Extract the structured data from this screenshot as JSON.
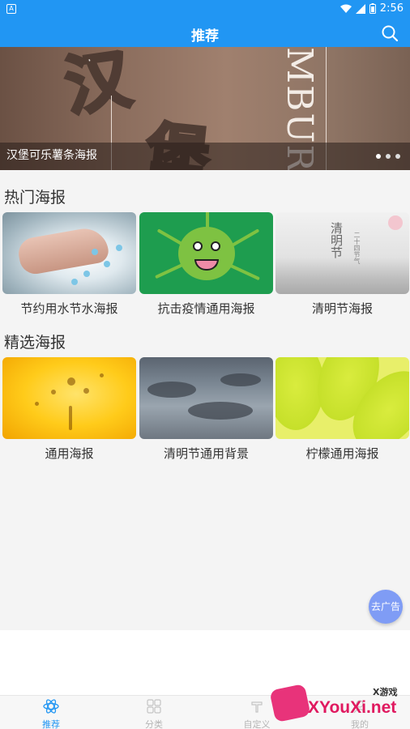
{
  "status_bar": {
    "time": "2:56",
    "left_icon": "app-notification-icon",
    "icons": [
      "wifi-icon",
      "signal-icon",
      "battery-icon"
    ]
  },
  "app_bar": {
    "title": "推荐",
    "search_icon": "search-icon"
  },
  "banner": {
    "caption": "汉堡可乐薯条海报",
    "deco_char_1": "汉",
    "deco_char_2": "堡",
    "deco_vertical_text": "MBUR",
    "slides": 3,
    "active_slide": 1
  },
  "sections": [
    {
      "title": "热门海报",
      "items": [
        {
          "label": "节约用水节水海报",
          "image": "water-hands"
        },
        {
          "label": "抗击疫情通用海报",
          "image": "green-virus"
        },
        {
          "label": "清明节海报",
          "image": "qingming-mist",
          "image_text": "清明节",
          "image_subtext": "二十四节气"
        }
      ]
    },
    {
      "title": "精选海报",
      "items": [
        {
          "label": "通用海报",
          "image": "yellow-splash"
        },
        {
          "label": "清明节通用背景",
          "image": "cloudy-sky"
        },
        {
          "label": "柠檬通用海报",
          "image": "lemon-slice"
        }
      ]
    }
  ],
  "fab": {
    "label": "去广告"
  },
  "tab_bar": {
    "tabs": [
      {
        "label": "推荐",
        "icon": "recommend-icon",
        "active": true
      },
      {
        "label": "分类",
        "icon": "category-icon",
        "active": false
      },
      {
        "label": "自定义",
        "icon": "custom-icon",
        "active": false
      },
      {
        "label": "我的",
        "icon": "profile-icon",
        "active": false
      }
    ]
  },
  "watermark": {
    "text": "XYouXi.net",
    "small": "X游戏"
  },
  "colors": {
    "primary": "#2196f3",
    "fab": "#7f9cf5",
    "watermark": "#e0195f"
  }
}
